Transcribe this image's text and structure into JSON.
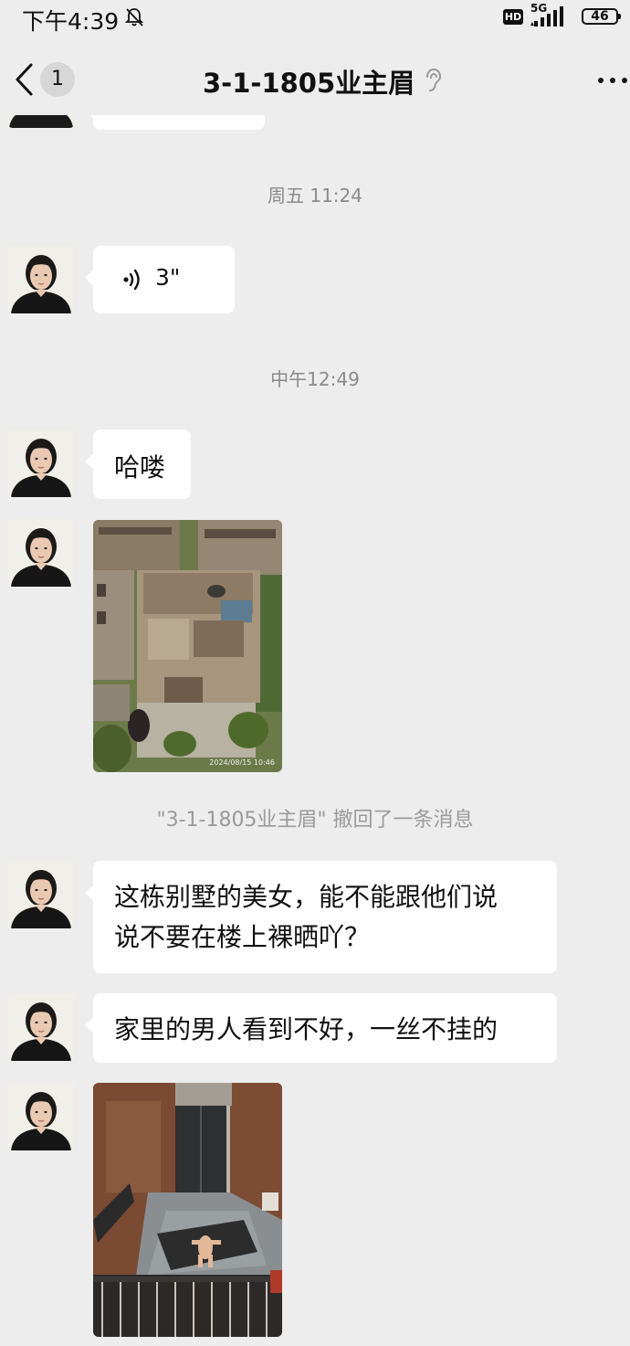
{
  "status_bar": {
    "time": "下午4:39",
    "hd": "HD",
    "network": "5G",
    "battery": "46"
  },
  "nav": {
    "unread_count": "1",
    "title": "3-1-1805业主眉"
  },
  "messages": {
    "ts1": "周五 11:24",
    "voice_duration": "3\"",
    "ts2": "中午12:49",
    "m1": "哈喽",
    "recall_notice": "\"3-1-1805业主眉\" 撤回了一条消息",
    "m2_line1": "这栋别墅的美女，能不能跟他们说",
    "m2_line2": "说不要在楼上裸晒吖？",
    "m3": "家里的男人看到不好，一丝不挂的",
    "photo1_stamp": "2024/08/15 10:46"
  },
  "colors": {
    "background": "#ededed",
    "bubble": "#ffffff",
    "muted_text": "#8a8a8a"
  }
}
